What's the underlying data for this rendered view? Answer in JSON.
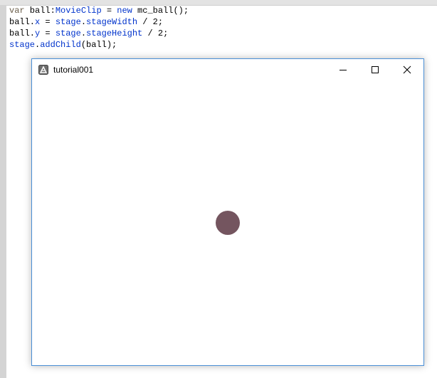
{
  "editor": {
    "lines": [
      [
        {
          "t": "var",
          "c": "var"
        },
        {
          "t": " ball:",
          "c": "id"
        },
        {
          "t": "MovieClip",
          "c": "type"
        },
        {
          "t": " = ",
          "c": "punc"
        },
        {
          "t": "new",
          "c": "kw"
        },
        {
          "t": " mc_ball();",
          "c": "id"
        }
      ],
      [
        {
          "t": "ball.",
          "c": "id"
        },
        {
          "t": "x",
          "c": "prop"
        },
        {
          "t": " = ",
          "c": "punc"
        },
        {
          "t": "stage",
          "c": "prop"
        },
        {
          "t": ".",
          "c": "punc"
        },
        {
          "t": "stageWidth",
          "c": "prop"
        },
        {
          "t": " / 2;",
          "c": "punc"
        }
      ],
      [
        {
          "t": "ball.",
          "c": "id"
        },
        {
          "t": "y",
          "c": "prop"
        },
        {
          "t": " = ",
          "c": "punc"
        },
        {
          "t": "stage",
          "c": "prop"
        },
        {
          "t": ".",
          "c": "punc"
        },
        {
          "t": "stageHeight",
          "c": "prop"
        },
        {
          "t": " / 2;",
          "c": "punc"
        }
      ],
      [
        {
          "t": "stage",
          "c": "prop"
        },
        {
          "t": ".",
          "c": "punc"
        },
        {
          "t": "addChild",
          "c": "prop"
        },
        {
          "t": "(ball);",
          "c": "punc"
        }
      ]
    ]
  },
  "window": {
    "title": "tutorial001",
    "app_icon": "adobe-air-icon",
    "buttons": {
      "minimize": "minimize-icon",
      "maximize": "maximize-icon",
      "close": "close-icon"
    },
    "border_color": "#4a8fd6"
  },
  "stage": {
    "ball_color": "#74555f",
    "background": "#ffffff"
  }
}
